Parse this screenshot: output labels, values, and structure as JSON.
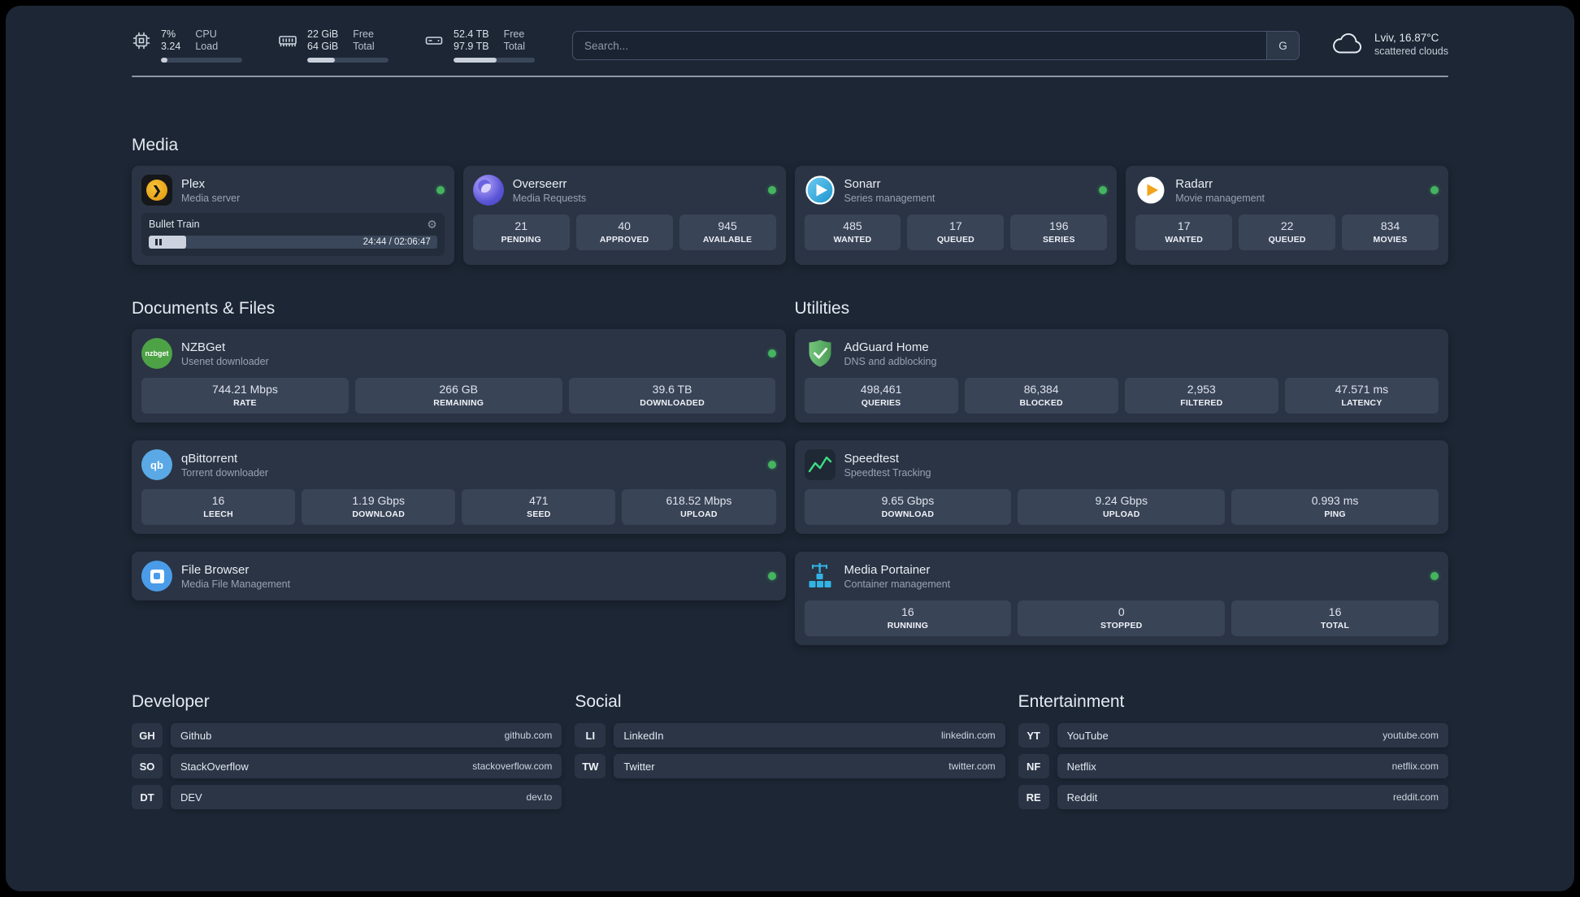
{
  "topbar": {
    "cpu": {
      "value_top": "7%",
      "value_bottom": "3.24",
      "label_top": "CPU",
      "label_bottom": "Load",
      "percent": 8
    },
    "memory": {
      "value_top": "22 GiB",
      "value_bottom": "64 GiB",
      "label_top": "Free",
      "label_bottom": "Total",
      "percent": 34
    },
    "disk": {
      "value_top": "52.4 TB",
      "value_bottom": "97.9 TB",
      "label_top": "Free",
      "label_bottom": "Total",
      "percent": 53
    },
    "search": {
      "placeholder": "Search...",
      "button_label": "G"
    },
    "weather": {
      "location": "Lviv, 16.87°C",
      "condition": "scattered clouds"
    }
  },
  "sections": {
    "media": {
      "title": "Media",
      "plex": {
        "name": "Plex",
        "desc": "Media server",
        "icon_glyph": "❯",
        "now_playing": "Bullet Train",
        "time": "24:44 / 02:06:47",
        "progress_percent": 13
      },
      "overseerr": {
        "name": "Overseerr",
        "desc": "Media Requests",
        "stats": [
          {
            "value": "21",
            "label": "PENDING"
          },
          {
            "value": "40",
            "label": "APPROVED"
          },
          {
            "value": "945",
            "label": "AVAILABLE"
          }
        ]
      },
      "sonarr": {
        "name": "Sonarr",
        "desc": "Series management",
        "stats": [
          {
            "value": "485",
            "label": "WANTED"
          },
          {
            "value": "17",
            "label": "QUEUED"
          },
          {
            "value": "196",
            "label": "SERIES"
          }
        ]
      },
      "radarr": {
        "name": "Radarr",
        "desc": "Movie management",
        "stats": [
          {
            "value": "17",
            "label": "WANTED"
          },
          {
            "value": "22",
            "label": "QUEUED"
          },
          {
            "value": "834",
            "label": "MOVIES"
          }
        ]
      }
    },
    "documents": {
      "title": "Documents & Files",
      "nzbget": {
        "name": "NZBGet",
        "desc": "Usenet downloader",
        "icon_label": "nzbget",
        "stats": [
          {
            "value": "744.21 Mbps",
            "label": "RATE"
          },
          {
            "value": "266 GB",
            "label": "REMAINING"
          },
          {
            "value": "39.6 TB",
            "label": "DOWNLOADED"
          }
        ]
      },
      "qbittorrent": {
        "name": "qBittorrent",
        "desc": "Torrent downloader",
        "icon_label": "qb",
        "stats": [
          {
            "value": "16",
            "label": "LEECH"
          },
          {
            "value": "1.19 Gbps",
            "label": "DOWNLOAD"
          },
          {
            "value": "471",
            "label": "SEED"
          },
          {
            "value": "618.52 Mbps",
            "label": "UPLOAD"
          }
        ]
      },
      "filebrowser": {
        "name": "File Browser",
        "desc": "Media File Management"
      }
    },
    "utilities": {
      "title": "Utilities",
      "adguard": {
        "name": "AdGuard Home",
        "desc": "DNS and adblocking",
        "stats": [
          {
            "value": "498,461",
            "label": "QUERIES"
          },
          {
            "value": "86,384",
            "label": "BLOCKED"
          },
          {
            "value": "2,953",
            "label": "FILTERED"
          },
          {
            "value": "47.571 ms",
            "label": "LATENCY"
          }
        ]
      },
      "speedtest": {
        "name": "Speedtest",
        "desc": "Speedtest Tracking",
        "stats": [
          {
            "value": "9.65 Gbps",
            "label": "DOWNLOAD"
          },
          {
            "value": "9.24 Gbps",
            "label": "UPLOAD"
          },
          {
            "value": "0.993 ms",
            "label": "PING"
          }
        ]
      },
      "portainer": {
        "name": "Media Portainer",
        "desc": "Container management",
        "stats": [
          {
            "value": "16",
            "label": "RUNNING"
          },
          {
            "value": "0",
            "label": "STOPPED"
          },
          {
            "value": "16",
            "label": "TOTAL"
          }
        ]
      }
    },
    "bookmarks": {
      "developer": {
        "title": "Developer",
        "items": [
          {
            "abbr": "GH",
            "name": "Github",
            "url": "github.com"
          },
          {
            "abbr": "SO",
            "name": "StackOverflow",
            "url": "stackoverflow.com"
          },
          {
            "abbr": "DT",
            "name": "DEV",
            "url": "dev.to"
          }
        ]
      },
      "social": {
        "title": "Social",
        "items": [
          {
            "abbr": "LI",
            "name": "LinkedIn",
            "url": "linkedin.com"
          },
          {
            "abbr": "TW",
            "name": "Twitter",
            "url": "twitter.com"
          }
        ]
      },
      "entertainment": {
        "title": "Entertainment",
        "items": [
          {
            "abbr": "YT",
            "name": "YouTube",
            "url": "youtube.com"
          },
          {
            "abbr": "NF",
            "name": "Netflix",
            "url": "netflix.com"
          },
          {
            "abbr": "RE",
            "name": "Reddit",
            "url": "reddit.com"
          }
        ]
      }
    }
  },
  "colors": {
    "background": "#1c2634",
    "card": "#2a3444",
    "status_online": "#44b45f",
    "speedtest_line": "#3ddc84"
  }
}
